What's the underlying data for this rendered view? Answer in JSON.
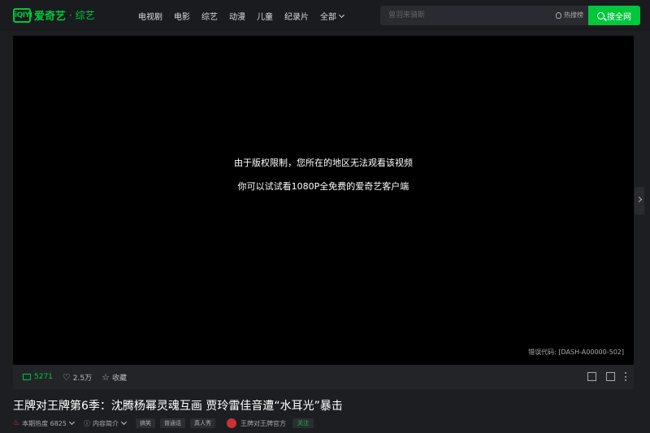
{
  "header": {
    "logo_badge": "iQIYI",
    "logo_text": "爱奇艺",
    "logo_channel": "· 综艺",
    "nav": [
      "电视剧",
      "电影",
      "综艺",
      "动漫",
      "儿童",
      "纪录片",
      "全部"
    ],
    "search_placeholder": "曾羽来骑斯",
    "hot_search_label": "热搜榜",
    "search_button": "搜全网"
  },
  "player": {
    "message_line1": "由于版权限制，您所在的地区无法观看该视频",
    "message_line2": "你可以试试看1080P全免费的爱奇艺客户端",
    "error_code": "错误代码: [DASH-A00000-502]"
  },
  "actions": {
    "comments": "5271",
    "likes": "2.5万",
    "collect": "收藏"
  },
  "video": {
    "title": "王牌对王牌第6季：沈腾杨幂灵魂互画 贾玲雷佳音遭“水耳光”暴击",
    "heat": "本期热度 6825",
    "intro": "内容简介",
    "tags": [
      "搞笑",
      "普通话",
      "真人秀"
    ],
    "channel_name": "王牌对王牌官方",
    "follow": "关注"
  },
  "colors": {
    "accent": "#00c73c",
    "background": "#1d1e22",
    "player": "#000000"
  }
}
